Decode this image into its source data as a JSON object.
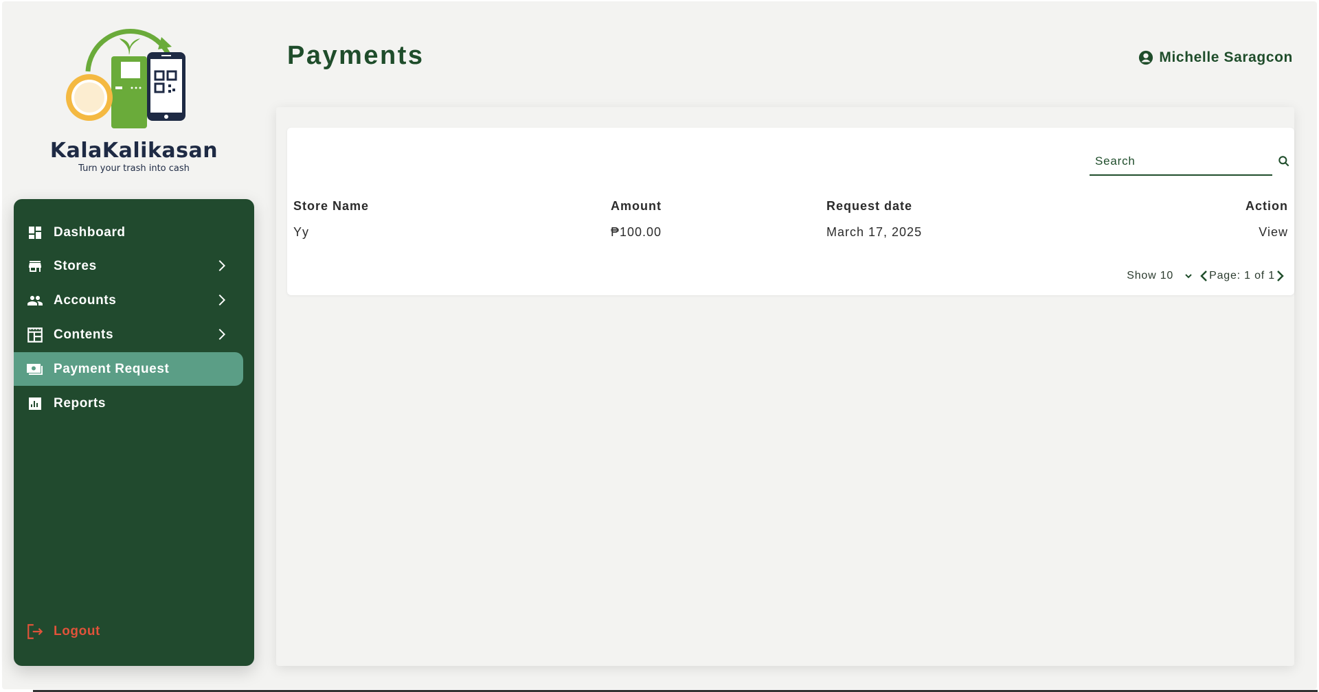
{
  "brand": {
    "name": "KalaKalikasan",
    "tagline": "Turn your trash into cash",
    "peso_symbol": "₱"
  },
  "colors": {
    "sidebar": "#214a2e",
    "active": "#5b9e86",
    "title": "#1f4d2b",
    "logout": "#e0533a",
    "logo_green": "#6aab3a",
    "logo_gold": "#f4b942"
  },
  "sidebar": {
    "items": [
      {
        "label": "Dashboard",
        "icon": "dashboard-icon",
        "has_submenu": false,
        "active": false
      },
      {
        "label": "Stores",
        "icon": "store-icon",
        "has_submenu": true,
        "active": false
      },
      {
        "label": "Accounts",
        "icon": "people-icon",
        "has_submenu": true,
        "active": false
      },
      {
        "label": "Contents",
        "icon": "layout-icon",
        "has_submenu": true,
        "active": false
      },
      {
        "label": "Payment Request",
        "icon": "cash-icon",
        "has_submenu": false,
        "active": true
      },
      {
        "label": "Reports",
        "icon": "bar-chart-icon",
        "has_submenu": false,
        "active": false
      }
    ],
    "logout": {
      "label": "Logout",
      "icon": "logout-icon"
    }
  },
  "header": {
    "title": "Payments",
    "user_name": "Michelle Saragcon",
    "user_icon": "account-circle-icon"
  },
  "search": {
    "placeholder": "Search",
    "value": ""
  },
  "table": {
    "columns": [
      "Store Name",
      "Amount",
      "Request date",
      "Action"
    ],
    "rows": [
      {
        "store_name": "Yy",
        "amount": "₱100.00",
        "request_date": "March 17, 2025",
        "action": "View"
      }
    ]
  },
  "pagination": {
    "show_label": "Show 10",
    "page_label": "Page: 1 of 1"
  }
}
